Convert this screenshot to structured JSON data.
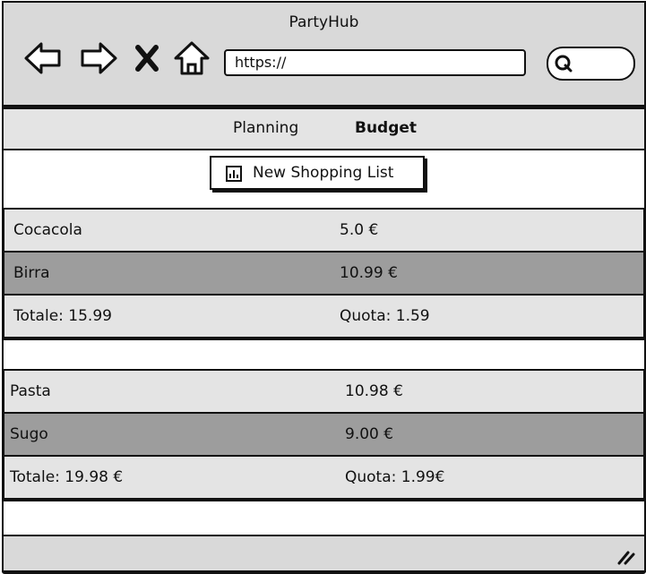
{
  "browser": {
    "title": "PartyHub",
    "url": "https://",
    "search_placeholder": ""
  },
  "tabs": [
    {
      "label": "Planning",
      "active": false
    },
    {
      "label": "Budget",
      "active": true
    }
  ],
  "new_list_button": {
    "label": "New Shopping List"
  },
  "lists": [
    {
      "rows": [
        {
          "item": "Cocacola",
          "price": "5.0 €"
        },
        {
          "item": "Birra",
          "price": "10.99 €"
        },
        {
          "item": "Totale: 15.99",
          "price": "Quota: 1.59"
        }
      ]
    },
    {
      "rows": [
        {
          "item": "Pasta",
          "price": "10.98 €"
        },
        {
          "item": "Sugo",
          "price": "9.00 €"
        },
        {
          "item": "Totale: 19.98 €",
          "price": "Quota: 1.99€"
        }
      ]
    }
  ]
}
